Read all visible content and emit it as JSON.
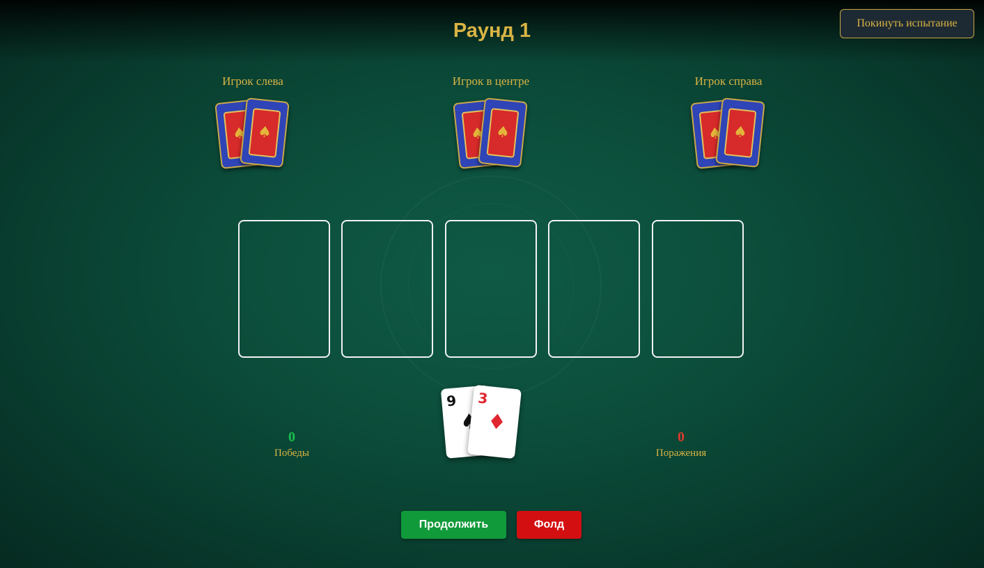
{
  "header": {
    "round_title": "Раунд 1",
    "exit_label": "Покинуть испытание"
  },
  "opponents": [
    {
      "label": "Игрок слева",
      "cards_shown": 2
    },
    {
      "label": "Игрок в центре",
      "cards_shown": 2
    },
    {
      "label": "Игрок справа",
      "cards_shown": 2
    }
  ],
  "card_back": {
    "suit_icon": "spade-icon",
    "colors": {
      "back": "#2f44b6",
      "inner": "#d72a2a",
      "trim": "#c8a84a"
    }
  },
  "community_cards": {
    "slots": 5,
    "revealed": []
  },
  "player_hand": [
    {
      "rank": "9",
      "suit": "♠",
      "suit_name": "spades",
      "color": "#111111"
    },
    {
      "rank": "3",
      "suit": "♦",
      "suit_name": "diamonds",
      "color": "#e0262e"
    }
  ],
  "stats": {
    "wins": {
      "value": "0",
      "label": "Победы",
      "color": "#1bbf4e"
    },
    "losses": {
      "value": "0",
      "label": "Поражения",
      "color": "#e03a2f"
    }
  },
  "actions": {
    "continue_label": "Продолжить",
    "fold_label": "Фолд",
    "continue_color": "#119a3a",
    "fold_color": "#d30f12"
  },
  "theme": {
    "accent": "#d9b444",
    "table": "#0c4f3c"
  }
}
